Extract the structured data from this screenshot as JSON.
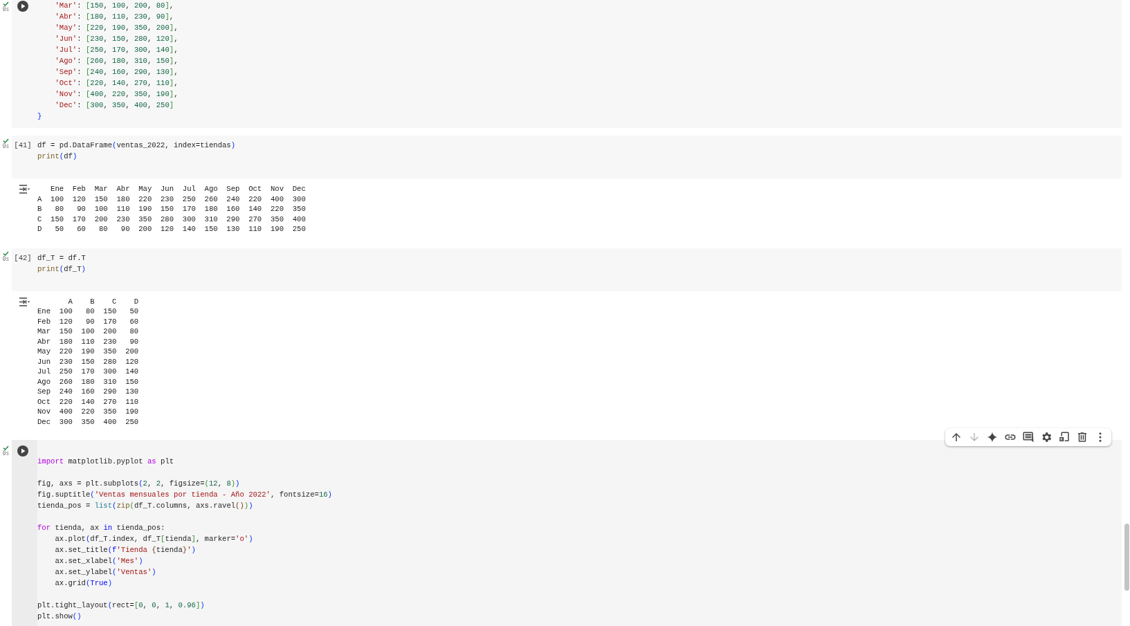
{
  "cells": [
    {
      "status": {
        "success": true,
        "duration": "0s"
      },
      "focused": false,
      "code": [
        {
          "indent": true,
          "tokens": [
            {
              "kind": "string",
              "text": "'Mar'"
            },
            {
              "kind": "plain",
              "text": ": "
            },
            {
              "kind": "bracket2",
              "text": "["
            },
            {
              "kind": "number",
              "text": "150"
            },
            {
              "kind": "plain",
              "text": ", "
            },
            {
              "kind": "number",
              "text": "100"
            },
            {
              "kind": "plain",
              "text": ", "
            },
            {
              "kind": "number",
              "text": "200"
            },
            {
              "kind": "plain",
              "text": ", "
            },
            {
              "kind": "number",
              "text": "80"
            },
            {
              "kind": "bracket2",
              "text": "]"
            },
            {
              "kind": "plain",
              "text": ","
            }
          ]
        },
        {
          "indent": true,
          "tokens": [
            {
              "kind": "string",
              "text": "'Abr'"
            },
            {
              "kind": "plain",
              "text": ": "
            },
            {
              "kind": "bracket2",
              "text": "["
            },
            {
              "kind": "number",
              "text": "180"
            },
            {
              "kind": "plain",
              "text": ", "
            },
            {
              "kind": "number",
              "text": "110"
            },
            {
              "kind": "plain",
              "text": ", "
            },
            {
              "kind": "number",
              "text": "230"
            },
            {
              "kind": "plain",
              "text": ", "
            },
            {
              "kind": "number",
              "text": "90"
            },
            {
              "kind": "bracket2",
              "text": "]"
            },
            {
              "kind": "plain",
              "text": ","
            }
          ]
        },
        {
          "indent": true,
          "tokens": [
            {
              "kind": "string",
              "text": "'May'"
            },
            {
              "kind": "plain",
              "text": ": "
            },
            {
              "kind": "bracket2",
              "text": "["
            },
            {
              "kind": "number",
              "text": "220"
            },
            {
              "kind": "plain",
              "text": ", "
            },
            {
              "kind": "number",
              "text": "190"
            },
            {
              "kind": "plain",
              "text": ", "
            },
            {
              "kind": "number",
              "text": "350"
            },
            {
              "kind": "plain",
              "text": ", "
            },
            {
              "kind": "number",
              "text": "200"
            },
            {
              "kind": "bracket2",
              "text": "]"
            },
            {
              "kind": "plain",
              "text": ","
            }
          ]
        },
        {
          "indent": true,
          "tokens": [
            {
              "kind": "string",
              "text": "'Jun'"
            },
            {
              "kind": "plain",
              "text": ": "
            },
            {
              "kind": "bracket2",
              "text": "["
            },
            {
              "kind": "number",
              "text": "230"
            },
            {
              "kind": "plain",
              "text": ", "
            },
            {
              "kind": "number",
              "text": "150"
            },
            {
              "kind": "plain",
              "text": ", "
            },
            {
              "kind": "number",
              "text": "280"
            },
            {
              "kind": "plain",
              "text": ", "
            },
            {
              "kind": "number",
              "text": "120"
            },
            {
              "kind": "bracket2",
              "text": "]"
            },
            {
              "kind": "plain",
              "text": ","
            }
          ]
        },
        {
          "indent": true,
          "tokens": [
            {
              "kind": "string",
              "text": "'Jul'"
            },
            {
              "kind": "plain",
              "text": ": "
            },
            {
              "kind": "bracket2",
              "text": "["
            },
            {
              "kind": "number",
              "text": "250"
            },
            {
              "kind": "plain",
              "text": ", "
            },
            {
              "kind": "number",
              "text": "170"
            },
            {
              "kind": "plain",
              "text": ", "
            },
            {
              "kind": "number",
              "text": "300"
            },
            {
              "kind": "plain",
              "text": ", "
            },
            {
              "kind": "number",
              "text": "140"
            },
            {
              "kind": "bracket2",
              "text": "]"
            },
            {
              "kind": "plain",
              "text": ","
            }
          ]
        },
        {
          "indent": true,
          "tokens": [
            {
              "kind": "string",
              "text": "'Ago'"
            },
            {
              "kind": "plain",
              "text": ": "
            },
            {
              "kind": "bracket2",
              "text": "["
            },
            {
              "kind": "number",
              "text": "260"
            },
            {
              "kind": "plain",
              "text": ", "
            },
            {
              "kind": "number",
              "text": "180"
            },
            {
              "kind": "plain",
              "text": ", "
            },
            {
              "kind": "number",
              "text": "310"
            },
            {
              "kind": "plain",
              "text": ", "
            },
            {
              "kind": "number",
              "text": "150"
            },
            {
              "kind": "bracket2",
              "text": "]"
            },
            {
              "kind": "plain",
              "text": ","
            }
          ]
        },
        {
          "indent": true,
          "tokens": [
            {
              "kind": "string",
              "text": "'Sep'"
            },
            {
              "kind": "plain",
              "text": ": "
            },
            {
              "kind": "bracket2",
              "text": "["
            },
            {
              "kind": "number",
              "text": "240"
            },
            {
              "kind": "plain",
              "text": ", "
            },
            {
              "kind": "number",
              "text": "160"
            },
            {
              "kind": "plain",
              "text": ", "
            },
            {
              "kind": "number",
              "text": "290"
            },
            {
              "kind": "plain",
              "text": ", "
            },
            {
              "kind": "number",
              "text": "130"
            },
            {
              "kind": "bracket2",
              "text": "]"
            },
            {
              "kind": "plain",
              "text": ","
            }
          ]
        },
        {
          "indent": true,
          "tokens": [
            {
              "kind": "string",
              "text": "'Oct'"
            },
            {
              "kind": "plain",
              "text": ": "
            },
            {
              "kind": "bracket2",
              "text": "["
            },
            {
              "kind": "number",
              "text": "220"
            },
            {
              "kind": "plain",
              "text": ", "
            },
            {
              "kind": "number",
              "text": "140"
            },
            {
              "kind": "plain",
              "text": ", "
            },
            {
              "kind": "number",
              "text": "270"
            },
            {
              "kind": "plain",
              "text": ", "
            },
            {
              "kind": "number",
              "text": "110"
            },
            {
              "kind": "bracket2",
              "text": "]"
            },
            {
              "kind": "plain",
              "text": ","
            }
          ]
        },
        {
          "indent": true,
          "tokens": [
            {
              "kind": "string",
              "text": "'Nov'"
            },
            {
              "kind": "plain",
              "text": ": "
            },
            {
              "kind": "bracket2",
              "text": "["
            },
            {
              "kind": "number",
              "text": "400"
            },
            {
              "kind": "plain",
              "text": ", "
            },
            {
              "kind": "number",
              "text": "220"
            },
            {
              "kind": "plain",
              "text": ", "
            },
            {
              "kind": "number",
              "text": "350"
            },
            {
              "kind": "plain",
              "text": ", "
            },
            {
              "kind": "number",
              "text": "190"
            },
            {
              "kind": "bracket2",
              "text": "]"
            },
            {
              "kind": "plain",
              "text": ","
            }
          ]
        },
        {
          "indent": true,
          "tokens": [
            {
              "kind": "string",
              "text": "'Dec'"
            },
            {
              "kind": "plain",
              "text": ": "
            },
            {
              "kind": "bracket2",
              "text": "["
            },
            {
              "kind": "number",
              "text": "300"
            },
            {
              "kind": "plain",
              "text": ", "
            },
            {
              "kind": "number",
              "text": "350"
            },
            {
              "kind": "plain",
              "text": ", "
            },
            {
              "kind": "number",
              "text": "400"
            },
            {
              "kind": "plain",
              "text": ", "
            },
            {
              "kind": "number",
              "text": "250"
            },
            {
              "kind": "bracket2",
              "text": "]"
            }
          ]
        },
        {
          "tokens": [
            {
              "kind": "bracket",
              "text": "}"
            }
          ]
        }
      ]
    },
    {
      "status": {
        "success": true,
        "duration": "0s"
      },
      "focused": false,
      "exec_count": "[41]",
      "code": [
        {
          "tokens": [
            {
              "kind": "plain",
              "text": "df = pd.DataFrame"
            },
            {
              "kind": "bracket",
              "text": "("
            },
            {
              "kind": "plain",
              "text": "ventas_2022, index=tiendas"
            },
            {
              "kind": "bracket",
              "text": ")"
            }
          ]
        },
        {
          "tokens": [
            {
              "kind": "function",
              "text": "print"
            },
            {
              "kind": "bracket",
              "text": "("
            },
            {
              "kind": "plain",
              "text": "df"
            },
            {
              "kind": "bracket",
              "text": ")"
            }
          ]
        }
      ],
      "output": [
        "   Ene  Feb  Mar  Abr  May  Jun  Jul  Ago  Sep  Oct  Nov  Dec",
        "A  100  120  150  180  220  230  250  260  240  220  400  300",
        "B   80   90  100  110  190  150  170  180  160  140  220  350",
        "C  150  170  200  230  350  280  300  310  290  270  350  400",
        "D   50   60   80   90  200  120  140  150  130  110  190  250"
      ]
    },
    {
      "status": {
        "success": true,
        "duration": "0s"
      },
      "focused": false,
      "exec_count": "[42]",
      "code": [
        {
          "tokens": [
            {
              "kind": "plain",
              "text": "df_T = df.T"
            }
          ]
        },
        {
          "tokens": [
            {
              "kind": "function",
              "text": "print"
            },
            {
              "kind": "bracket",
              "text": "("
            },
            {
              "kind": "plain",
              "text": "df_T"
            },
            {
              "kind": "bracket",
              "text": ")"
            }
          ]
        }
      ],
      "output": [
        "       A    B    C    D",
        "Ene  100   80  150   50",
        "Feb  120   90  170   60",
        "Mar  150  100  200   80",
        "Abr  180  110  230   90",
        "May  220  190  350  200",
        "Jun  230  150  280  120",
        "Jul  250  170  300  140",
        "Ago  260  180  310  150",
        "Sep  240  160  290  130",
        "Oct  220  140  270  110",
        "Nov  400  220  350  190",
        "Dec  300  350  400  250"
      ]
    },
    {
      "status": {
        "success": true,
        "duration": "0s"
      },
      "focused": true,
      "toolbar": [
        {
          "kind": "up",
          "disabled": false
        },
        {
          "kind": "down",
          "disabled": true
        },
        {
          "kind": "sparkle",
          "disabled": false
        },
        {
          "kind": "link",
          "disabled": false
        },
        {
          "kind": "comment",
          "disabled": false
        },
        {
          "kind": "settings",
          "disabled": false
        },
        {
          "kind": "mirror",
          "disabled": false
        },
        {
          "kind": "delete",
          "disabled": false
        },
        {
          "kind": "more",
          "disabled": false
        }
      ],
      "code": [
        {
          "kind": "blank"
        },
        {
          "kind": "code",
          "tokens": [
            {
              "kind": "keyword",
              "text": "import"
            },
            {
              "kind": "plain",
              "text": " matplotlib.pyplot "
            },
            {
              "kind": "keyword",
              "text": "as"
            },
            {
              "kind": "plain",
              "text": " plt"
            }
          ]
        },
        {
          "kind": "blank"
        },
        {
          "kind": "code",
          "tokens": [
            {
              "kind": "plain",
              "text": "fig, axs = plt.subplots"
            },
            {
              "kind": "bracket",
              "text": "("
            },
            {
              "kind": "number",
              "text": "2"
            },
            {
              "kind": "plain",
              "text": ", "
            },
            {
              "kind": "number",
              "text": "2"
            },
            {
              "kind": "plain",
              "text": ", figsize="
            },
            {
              "kind": "bracket2",
              "text": "("
            },
            {
              "kind": "number",
              "text": "12"
            },
            {
              "kind": "plain",
              "text": ", "
            },
            {
              "kind": "number",
              "text": "8"
            },
            {
              "kind": "bracket2",
              "text": ")"
            },
            {
              "kind": "bracket",
              "text": ")"
            }
          ]
        },
        {
          "tokens": [
            {
              "kind": "plain",
              "text": "fig.suptitle"
            },
            {
              "kind": "bracket",
              "text": "("
            },
            {
              "kind": "string",
              "text": "'Ventas mensuales por tienda - Año 2022'"
            },
            {
              "kind": "plain",
              "text": ", fontsize="
            },
            {
              "kind": "number",
              "text": "16"
            },
            {
              "kind": "bracket",
              "text": ")"
            }
          ]
        },
        {
          "tokens": [
            {
              "kind": "plain",
              "text": "tienda_pos = "
            },
            {
              "kind": "type",
              "text": "list"
            },
            {
              "kind": "bracket",
              "text": "("
            },
            {
              "kind": "function",
              "text": "zip"
            },
            {
              "kind": "bracket2",
              "text": "("
            },
            {
              "kind": "plain",
              "text": "df_T.columns, axs.ravel"
            },
            {
              "kind": "bracket3",
              "text": "()"
            },
            {
              "kind": "bracket2",
              "text": ")"
            },
            {
              "kind": "bracket",
              "text": ")"
            }
          ]
        },
        {
          "kind": "blank"
        },
        {
          "kind": "code",
          "tokens": [
            {
              "kind": "keyword",
              "text": "for"
            },
            {
              "kind": "plain",
              "text": " tienda, ax "
            },
            {
              "kind": "constant",
              "text": "in"
            },
            {
              "kind": "plain",
              "text": " tienda_pos:"
            }
          ]
        },
        {
          "indent": true,
          "tokens": [
            {
              "kind": "plain",
              "text": "ax.plot"
            },
            {
              "kind": "bracket",
              "text": "("
            },
            {
              "kind": "plain",
              "text": "df_T.index, df_T"
            },
            {
              "kind": "bracket2",
              "text": "["
            },
            {
              "kind": "plain",
              "text": "tienda"
            },
            {
              "kind": "bracket2",
              "text": "]"
            },
            {
              "kind": "plain",
              "text": ", marker="
            },
            {
              "kind": "string",
              "text": "'o'"
            },
            {
              "kind": "bracket",
              "text": ")"
            }
          ]
        },
        {
          "indent": true,
          "tokens": [
            {
              "kind": "plain",
              "text": "ax.set_title"
            },
            {
              "kind": "bracket",
              "text": "("
            },
            {
              "kind": "constant",
              "text": "f"
            },
            {
              "kind": "string",
              "text": "'Tienda "
            },
            {
              "kind": "bracket3",
              "text": "{"
            },
            {
              "kind": "plain",
              "text": "tienda"
            },
            {
              "kind": "bracket3",
              "text": "}"
            },
            {
              "kind": "string",
              "text": "'"
            },
            {
              "kind": "bracket",
              "text": ")"
            }
          ]
        },
        {
          "indent": true,
          "tokens": [
            {
              "kind": "plain",
              "text": "ax.set_xlabel"
            },
            {
              "kind": "bracket",
              "text": "("
            },
            {
              "kind": "string",
              "text": "'Mes'"
            },
            {
              "kind": "bracket",
              "text": ")"
            }
          ]
        },
        {
          "indent": true,
          "tokens": [
            {
              "kind": "plain",
              "text": "ax.set_ylabel"
            },
            {
              "kind": "bracket",
              "text": "("
            },
            {
              "kind": "string",
              "text": "'Ventas'"
            },
            {
              "kind": "bracket",
              "text": ")"
            }
          ]
        },
        {
          "indent": true,
          "tokens": [
            {
              "kind": "plain",
              "text": "ax.grid"
            },
            {
              "kind": "bracket",
              "text": "("
            },
            {
              "kind": "constant",
              "text": "True"
            },
            {
              "kind": "bracket",
              "text": ")"
            }
          ]
        },
        {
          "kind": "blank"
        },
        {
          "kind": "code",
          "tokens": [
            {
              "kind": "plain",
              "text": "plt.tight_layout"
            },
            {
              "kind": "bracket",
              "text": "("
            },
            {
              "kind": "plain",
              "text": "rect="
            },
            {
              "kind": "bracket2",
              "text": "["
            },
            {
              "kind": "number",
              "text": "0"
            },
            {
              "kind": "plain",
              "text": ", "
            },
            {
              "kind": "number",
              "text": "0"
            },
            {
              "kind": "plain",
              "text": ", "
            },
            {
              "kind": "number",
              "text": "1"
            },
            {
              "kind": "plain",
              "text": ", "
            },
            {
              "kind": "number",
              "text": "0.96"
            },
            {
              "kind": "bracket2",
              "text": "]"
            },
            {
              "kind": "bracket",
              "text": ")"
            }
          ]
        },
        {
          "tokens": [
            {
              "kind": "plain",
              "text": "plt.show"
            },
            {
              "kind": "bracket",
              "text": "()"
            }
          ]
        }
      ]
    }
  ]
}
